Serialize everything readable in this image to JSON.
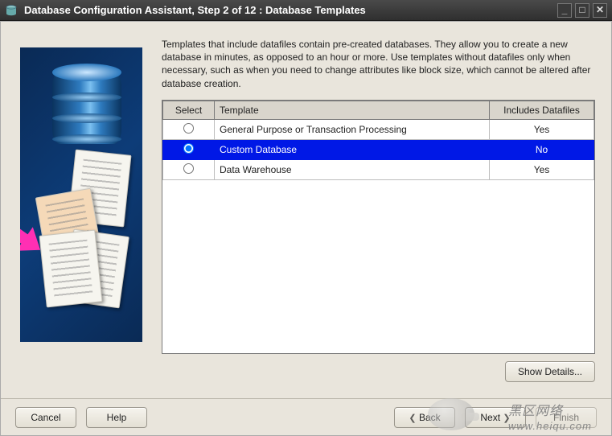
{
  "window": {
    "title": "Database Configuration Assistant, Step 2 of 12 : Database Templates"
  },
  "intro": "Templates that include datafiles contain pre-created databases. They allow you to create a new database in minutes, as opposed to an hour or more. Use templates without datafiles only when necessary, such as when you need to change attributes like block size, which cannot be altered after database creation.",
  "table": {
    "headers": {
      "select": "Select",
      "template": "Template",
      "includes": "Includes Datafiles"
    },
    "rows": [
      {
        "template": "General Purpose or Transaction Processing",
        "includes": "Yes",
        "selected": false
      },
      {
        "template": "Custom Database",
        "includes": "No",
        "selected": true
      },
      {
        "template": "Data Warehouse",
        "includes": "Yes",
        "selected": false
      }
    ]
  },
  "buttons": {
    "show_details": "Show Details...",
    "cancel": "Cancel",
    "help": "Help",
    "back": "Back",
    "next": "Next",
    "finish": "Finish"
  },
  "watermark": {
    "text": "黑区网络",
    "url": "www.heiqu.com"
  }
}
